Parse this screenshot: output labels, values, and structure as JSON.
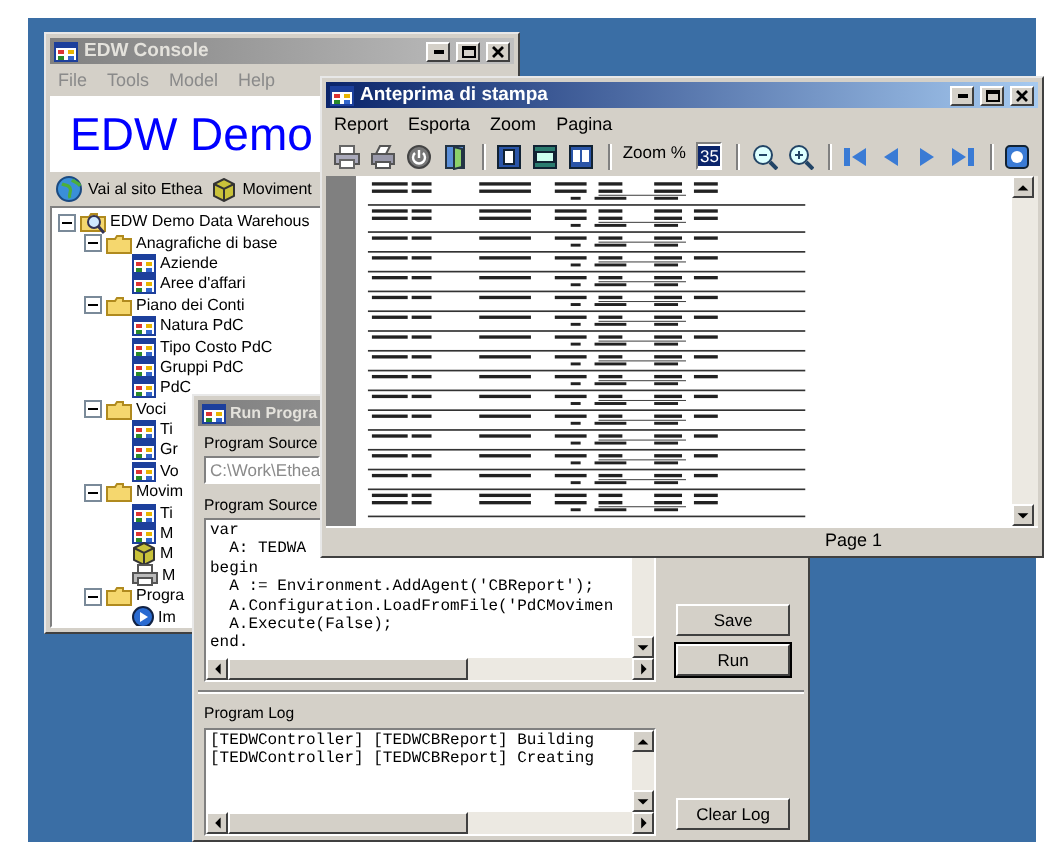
{
  "console": {
    "title": "EDW Console",
    "active": false,
    "menu": [
      {
        "label": "File",
        "disabled": true
      },
      {
        "label": "Tools",
        "disabled": true
      },
      {
        "label": "Model",
        "disabled": true
      },
      {
        "label": "Help",
        "disabled": true
      }
    ],
    "banner": "EDW Demo",
    "toolbar": [
      {
        "label": "Vai al sito Ethea",
        "kind": "globe"
      },
      {
        "label": "Moviment",
        "kind": "cube"
      }
    ],
    "tree": [
      {
        "label": "EDW Demo Data Warehous",
        "kind": "root",
        "expanded": true,
        "children": [
          {
            "label": "Anagrafiche di base",
            "kind": "folder",
            "expanded": true,
            "children": [
              {
                "label": "Aziende",
                "kind": "table"
              },
              {
                "label": "Aree d'affari",
                "kind": "table"
              }
            ]
          },
          {
            "label": "Piano dei Conti",
            "kind": "folder",
            "expanded": true,
            "children": [
              {
                "label": "Natura PdC",
                "kind": "table"
              },
              {
                "label": "Tipo Costo PdC",
                "kind": "table"
              },
              {
                "label": "Gruppi PdC",
                "kind": "table"
              },
              {
                "label": "PdC",
                "kind": "table"
              }
            ]
          },
          {
            "label": "Voci",
            "kind": "folder",
            "expanded": true,
            "children": [
              {
                "label": "Ti",
                "kind": "table"
              },
              {
                "label": "Gr",
                "kind": "table"
              },
              {
                "label": "Vo",
                "kind": "table"
              }
            ]
          },
          {
            "label": "Movim",
            "kind": "folder",
            "expanded": true,
            "children": [
              {
                "label": "Ti",
                "kind": "table"
              },
              {
                "label": "M",
                "kind": "table"
              },
              {
                "label": "M",
                "kind": "cube"
              },
              {
                "label": "M",
                "kind": "printer"
              }
            ]
          },
          {
            "label": "Progra",
            "kind": "folder",
            "expanded": true,
            "children": [
              {
                "label": "Im",
                "kind": "run"
              }
            ]
          }
        ]
      }
    ]
  },
  "run_program": {
    "title": "Run Progra",
    "active": false,
    "source_label": "Program Source",
    "source_field": {
      "value": "C:\\Work\\Ethea",
      "disabled": true
    },
    "code_label": "Program Source",
    "code": [
      "var",
      "  A: TEDWA",
      "begin",
      "  A := Environment.AddAgent('CBReport');",
      "  A.Configuration.LoadFromFile('PdCMovimen",
      "  A.Execute(False);",
      "end."
    ],
    "buttons": [
      {
        "label": "Save",
        "default": false
      },
      {
        "label": "Run",
        "default": true
      }
    ],
    "log_label": "Program Log",
    "log": [
      "[TEDWController] [TEDWCBReport] Building",
      "[TEDWController] [TEDWCBReport] Creating"
    ],
    "log_button": "Clear Log"
  },
  "preview": {
    "title": "Anteprima di stampa",
    "active": true,
    "menu": [
      "Report",
      "Esporta",
      "Zoom",
      "Pagina"
    ],
    "zoom_label": "Zoom %",
    "zoom_value": "35",
    "status": "Page 1"
  }
}
